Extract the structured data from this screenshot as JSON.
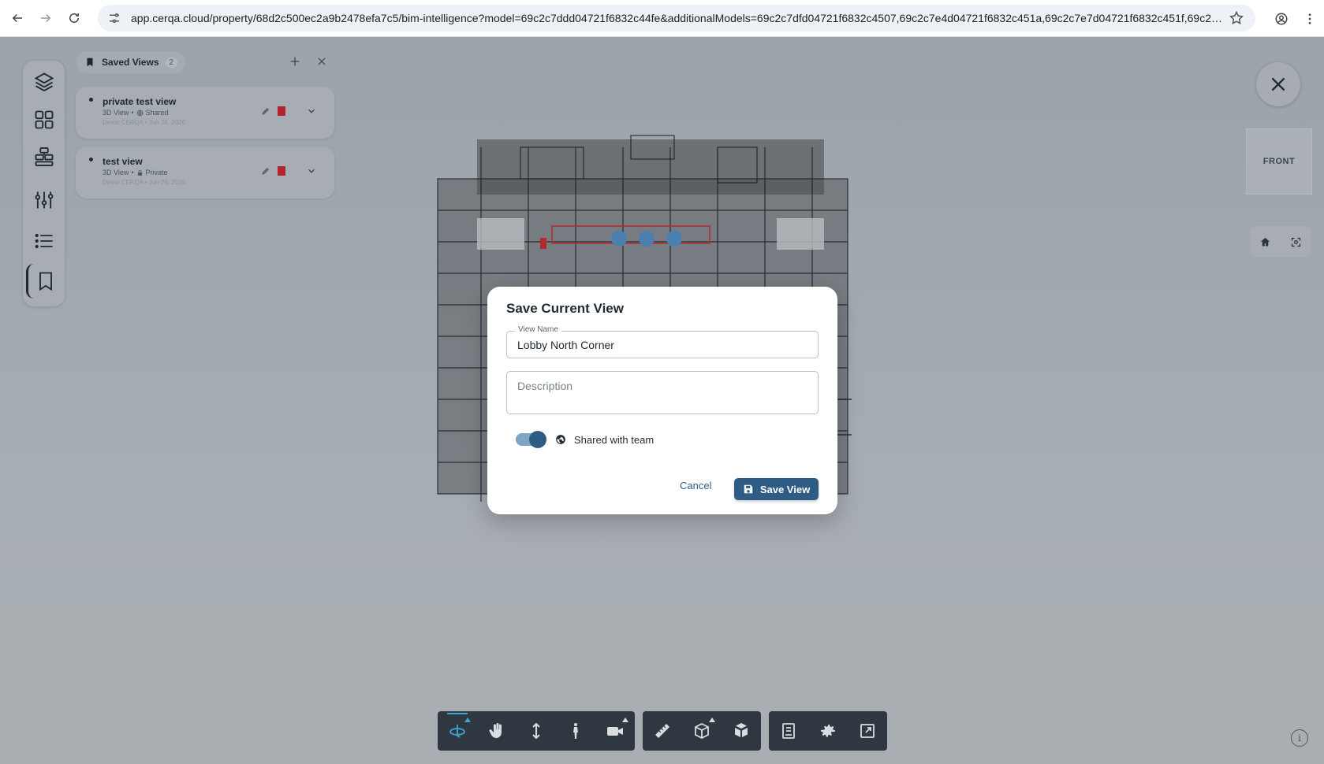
{
  "browser": {
    "url": "app.cerqa.cloud/property/68d2c500ec2a9b2478efa7c5/bim-intelligence?model=69c2c7ddd04721f6832c44fe&additionalModels=69c2c7dfd04721f6832c4507,69c2c7e4d04721f6832c451a,69c2c7e7d04721f6832c451f,69c2c89..."
  },
  "saved_views": {
    "title": "Saved Views",
    "count": "2",
    "items": [
      {
        "name": "private test view",
        "type": "3D View",
        "visibility": "Shared",
        "author_date": "Demo CERQA • Jun 26, 2026"
      },
      {
        "name": "test view",
        "type": "3D View",
        "visibility": "Private",
        "author_date": "Demo CERQA • Jun 26, 2026"
      }
    ]
  },
  "view_cube": {
    "face": "FRONT"
  },
  "modal": {
    "title": "Save Current View",
    "name_label": "View Name",
    "name_value": "Lobby North Corner",
    "description_placeholder": "Description",
    "toggle_label": "Shared with team",
    "toggle_on": true,
    "cancel_label": "Cancel",
    "save_label": "Save View"
  },
  "colors": {
    "primary": "#2f5c85",
    "toolbar_bg": "#2f3840",
    "active_tool": "#3fa3d6",
    "delete": "#b3232d"
  },
  "toolbar": {
    "groups": [
      [
        "orbit-icon",
        "pan-hand-icon",
        "vertical-move-icon",
        "walk-person-icon",
        "camera-icon"
      ],
      [
        "measure-ruler-icon",
        "section-box-icon",
        "explode-model-icon"
      ],
      [
        "properties-panel-icon",
        "settings-gear-icon",
        "fullscreen-icon"
      ]
    ],
    "active": "orbit-icon"
  },
  "info": {
    "symbol": "i"
  }
}
